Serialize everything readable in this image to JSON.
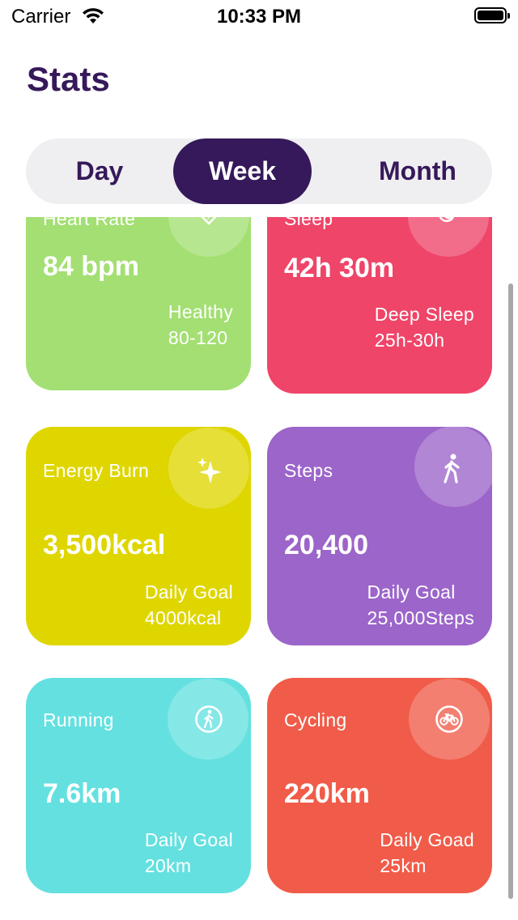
{
  "status_bar": {
    "carrier": "Carrier",
    "time": "10:33 PM"
  },
  "header": {
    "title": "Stats"
  },
  "segments": {
    "day": "Day",
    "week": "Week",
    "month": "Month",
    "selected": "Week"
  },
  "cards": {
    "heart_rate": {
      "label": "Heart Rate",
      "value": "84 bpm",
      "sub1": "Healthy",
      "sub2": "80-120",
      "color": "#a3df72",
      "icon": "heart-bolt-icon"
    },
    "sleep": {
      "label": "Sleep",
      "value": "42h 30m",
      "sub1": "Deep Sleep",
      "sub2": "25h-30h",
      "color": "#ef4569",
      "icon": "moon-icon"
    },
    "energy": {
      "label": "Energy Burn",
      "value": "3,500kcal",
      "sub1": "Daily Goal",
      "sub2": "4000kcal",
      "color": "#dfd600",
      "icon": "sparkles-icon"
    },
    "steps": {
      "label": "Steps",
      "value": "20,400",
      "sub1": "Daily Goal",
      "sub2": "25,000Steps",
      "color": "#9c65ca",
      "icon": "walking-icon"
    },
    "running": {
      "label": "Running",
      "value": "7.6km",
      "sub1": "Daily Goal",
      "sub2": "20km",
      "color": "#64e0e0",
      "icon": "running-icon"
    },
    "cycling": {
      "label": "Cycling",
      "value": "220km",
      "sub1": "Daily Goad",
      "sub2": "25km",
      "color": "#f05c49",
      "icon": "bicycle-icon"
    }
  }
}
